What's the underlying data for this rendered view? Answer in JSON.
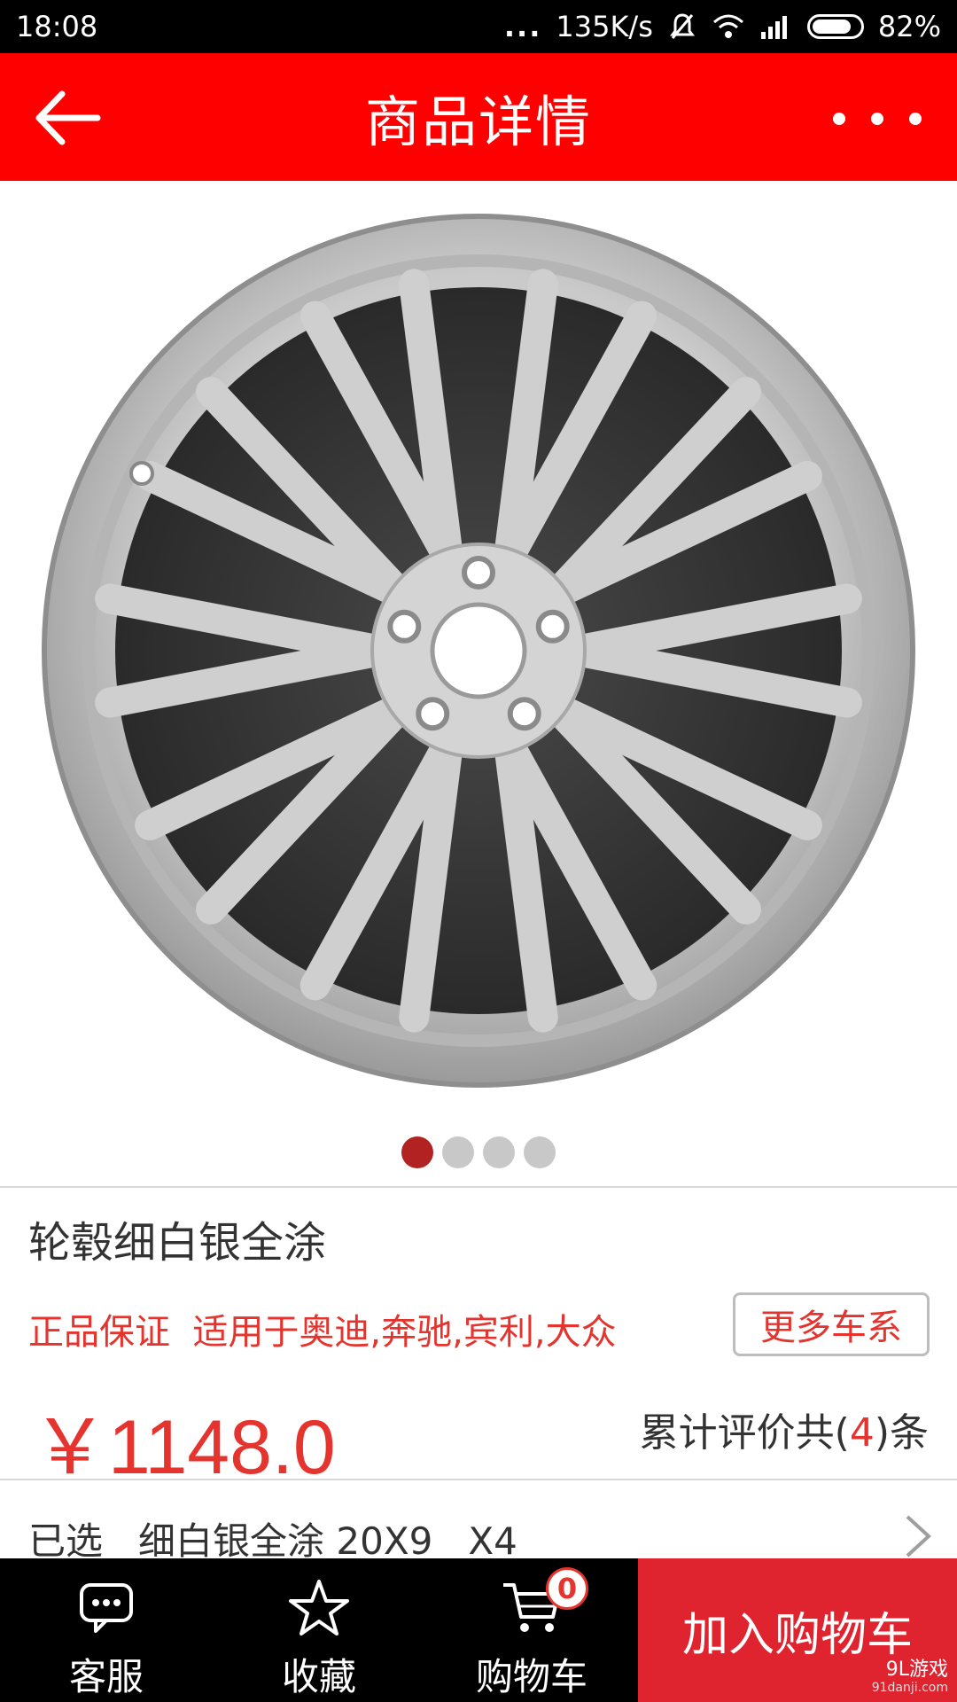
{
  "status_bar": {
    "time": "18:08",
    "dots": "...",
    "speed": "135K/s",
    "battery": "82%",
    "battery_level": 0.82
  },
  "header": {
    "title": "商品详情",
    "back_icon": "arrow-left-icon",
    "more_icon": "more-dots-icon"
  },
  "gallery": {
    "image_icon": "alloy-wheel-image",
    "page_count": 4,
    "active_index": 0
  },
  "product": {
    "name": "轮毂细白银全涂",
    "promo": "正品保证  适用于奥迪,奔驰,宾利,大众",
    "more_series_label": "更多车系",
    "price": "￥1148.0",
    "reviews_prefix": "累计评价共(",
    "reviews_count": "4",
    "reviews_suffix": ")条",
    "selected_text": "已选   细白银全涂 20X9   X4"
  },
  "bottom_bar": {
    "service_label": "客服",
    "favorite_label": "收藏",
    "cart_label": "购物车",
    "cart_badge": "0",
    "add_to_cart_label": "加入购物车",
    "watermark": "9L游戏",
    "watermark_url": "91danji.com"
  },
  "colors": {
    "header": "#ff0000",
    "accent": "#e5332e",
    "add_cart": "#e0242f",
    "bottom_bar": "#000000"
  }
}
